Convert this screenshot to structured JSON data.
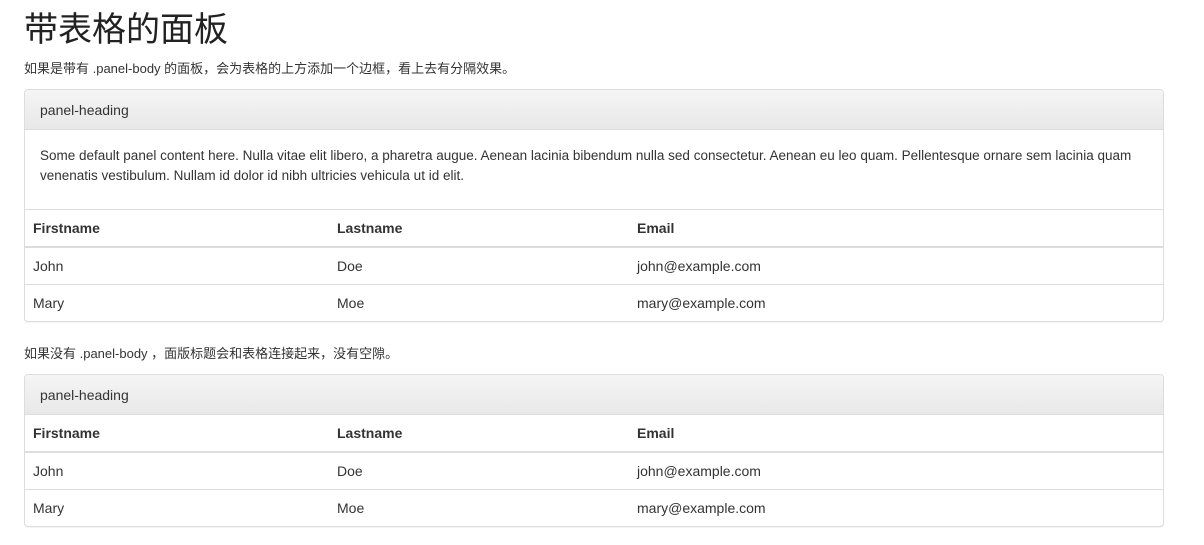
{
  "page_title": "带表格的面板",
  "section1": {
    "description": "如果是带有 .panel-body 的面板，会为表格的上方添加一个边框，看上去有分隔效果。",
    "heading": "panel-heading",
    "body_text": "Some default panel content here. Nulla vitae elit libero, a pharetra augue. Aenean lacinia bibendum nulla sed consectetur. Aenean eu leo quam. Pellentesque ornare sem lacinia quam venenatis vestibulum. Nullam id dolor id nibh ultricies vehicula ut id elit.",
    "table": {
      "headers": [
        "Firstname",
        "Lastname",
        "Email"
      ],
      "rows": [
        [
          "John",
          "Doe",
          "john@example.com"
        ],
        [
          "Mary",
          "Moe",
          "mary@example.com"
        ]
      ]
    }
  },
  "section2": {
    "description": "如果没有 .panel-body ，面版标题会和表格连接起来，没有空隙。",
    "heading": "panel-heading",
    "table": {
      "headers": [
        "Firstname",
        "Lastname",
        "Email"
      ],
      "rows": [
        [
          "John",
          "Doe",
          "john@example.com"
        ],
        [
          "Mary",
          "Moe",
          "mary@example.com"
        ]
      ]
    }
  }
}
